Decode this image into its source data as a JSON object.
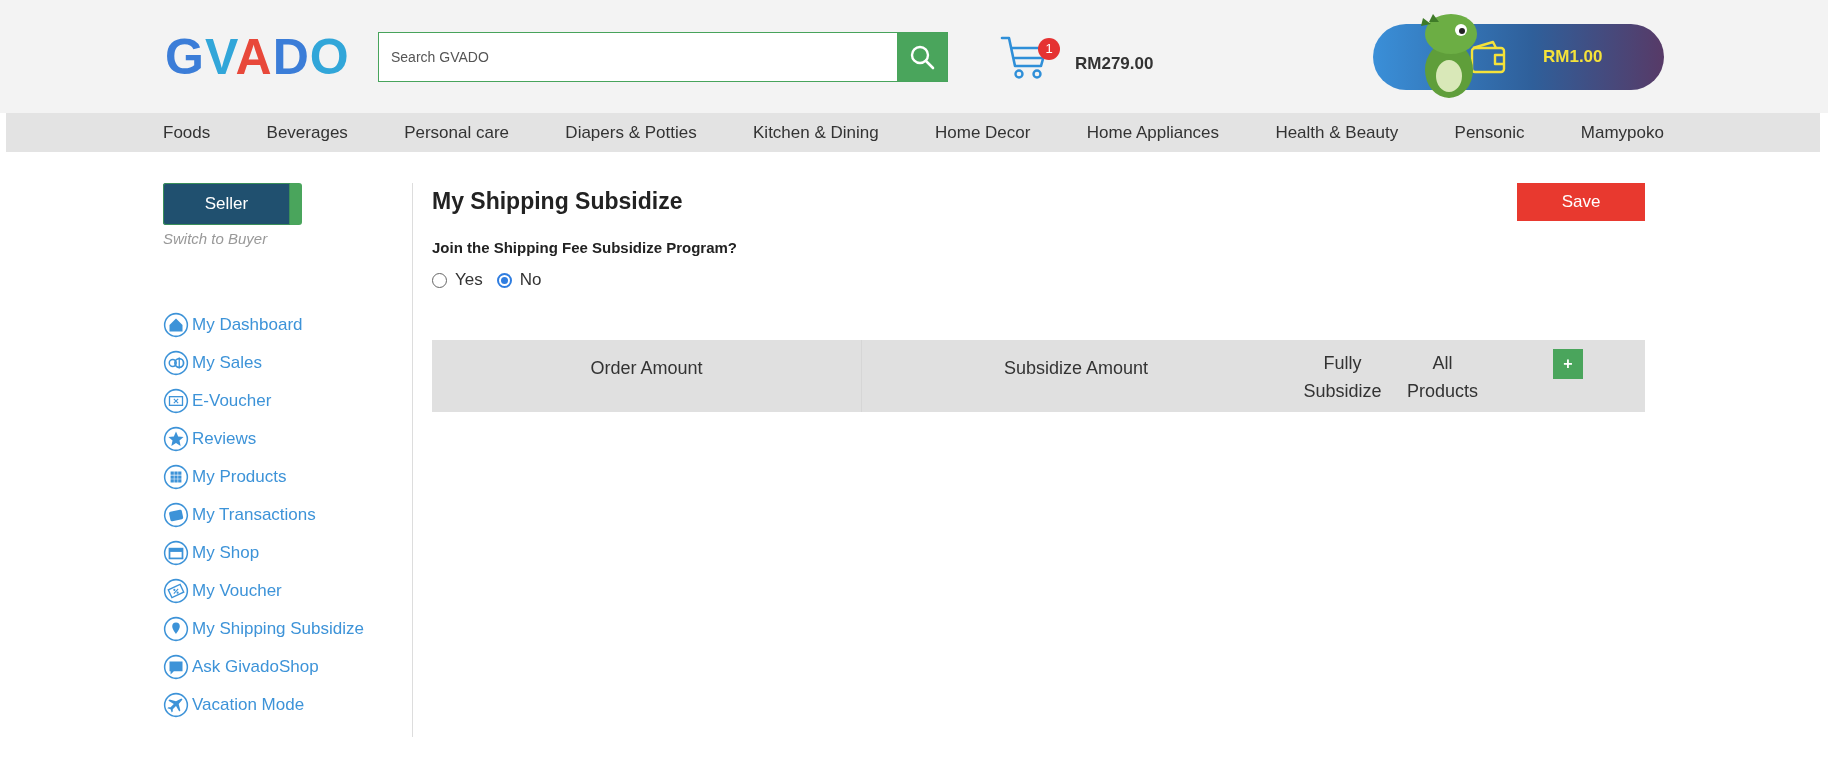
{
  "header": {
    "logo": "GVADO",
    "search": {
      "placeholder": "Search GVADO"
    },
    "cart": {
      "count": "1",
      "total": "RM279.00"
    },
    "wallet": {
      "balance": "RM1.00"
    }
  },
  "categories": [
    "Foods",
    "Beverages",
    "Personal care",
    "Diapers & Potties",
    "Kitchen & Dining",
    "Home Decor",
    "Home Appliances",
    "Health & Beauty",
    "Pensonic",
    "Mamypoko"
  ],
  "sidebar": {
    "role_button": "Seller",
    "switch_link": "Switch to Buyer",
    "items": [
      "My Dashboard",
      "My Sales",
      "E-Voucher",
      "Reviews",
      "My Products",
      "My Transactions",
      "My Shop",
      "My Voucher",
      "My Shipping Subsidize",
      "Ask GivadoShop",
      "Vacation Mode"
    ]
  },
  "page": {
    "title": "My Shipping Subsidize",
    "save_button": "Save",
    "question": "Join the Shipping Fee Subsidize Program?",
    "options": [
      {
        "label": "Yes",
        "selected": false
      },
      {
        "label": "No",
        "selected": true
      }
    ],
    "table": {
      "columns": [
        "Order Amount",
        "Subsidize Amount",
        "Fully Subsidize",
        "All Products"
      ],
      "add_button": "+"
    }
  }
}
